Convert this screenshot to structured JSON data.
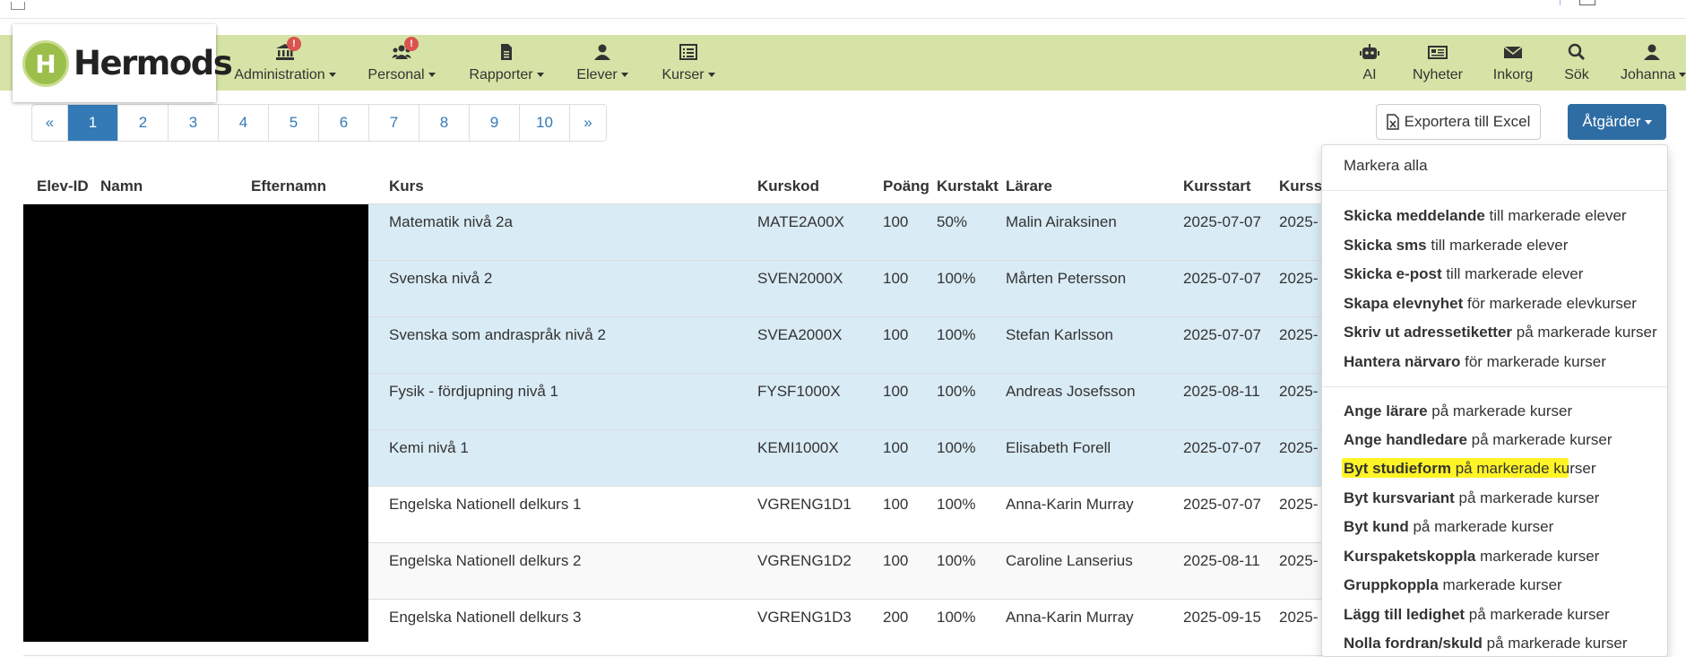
{
  "brand": {
    "logo_letter": "H",
    "logo_text": "Hermods"
  },
  "nav_left": [
    {
      "label": "Administration",
      "icon": "bank-icon",
      "badge": "!"
    },
    {
      "label": "Personal",
      "icon": "users-icon",
      "badge": "!"
    },
    {
      "label": "Rapporter",
      "icon": "file-icon"
    },
    {
      "label": "Elever",
      "icon": "user-icon"
    },
    {
      "label": "Kurser",
      "icon": "list-icon"
    }
  ],
  "nav_right": [
    {
      "label": "AI",
      "icon": "robot-icon"
    },
    {
      "label": "Nyheter",
      "icon": "newspaper-icon"
    },
    {
      "label": "Inkorg",
      "icon": "envelope-icon"
    },
    {
      "label": "Sök",
      "icon": "search-icon"
    },
    {
      "label": "Johanna",
      "icon": "user-icon"
    }
  ],
  "pagination": {
    "prev": "«",
    "pages": [
      "1",
      "2",
      "3",
      "4",
      "5",
      "6",
      "7",
      "8",
      "9",
      "10"
    ],
    "next": "»",
    "active": "1"
  },
  "toolbar": {
    "export_label": "Exportera till Excel",
    "actions_label": "Åtgärder"
  },
  "table": {
    "columns": [
      "Elev-ID",
      "Namn",
      "Efternamn",
      "Kurs",
      "Kurskod",
      "Poäng",
      "Kurstakt",
      "Lärare",
      "Kursstart",
      "Kurssl"
    ],
    "rows": [
      {
        "kurs": "Matematik nivå 2a",
        "kod": "MATE2A00X",
        "poang": "100",
        "takt": "50%",
        "larare": "Malin Airaksinen",
        "start": "2025-07-07",
        "slut": "2025-",
        "style": "hl"
      },
      {
        "kurs": "Svenska nivå 2",
        "kod": "SVEN2000X",
        "poang": "100",
        "takt": "100%",
        "larare": "Mårten Petersson",
        "start": "2025-07-07",
        "slut": "2025-",
        "style": "hl"
      },
      {
        "kurs": "Svenska som andraspråk nivå 2",
        "kod": "SVEA2000X",
        "poang": "100",
        "takt": "100%",
        "larare": "Stefan Karlsson",
        "start": "2025-07-07",
        "slut": "2025-",
        "style": "hl"
      },
      {
        "kurs": "Fysik - fördjupning nivå 1",
        "kod": "FYSF1000X",
        "poang": "100",
        "takt": "100%",
        "larare": "Andreas Josefsson",
        "start": "2025-08-11",
        "slut": "2025-",
        "style": "hl"
      },
      {
        "kurs": "Kemi nivå 1",
        "kod": "KEMI1000X",
        "poang": "100",
        "takt": "100%",
        "larare": "Elisabeth Forell",
        "start": "2025-07-07",
        "slut": "2025-",
        "style": "hl"
      },
      {
        "kurs": "Engelska Nationell delkurs 1",
        "kod": "VGRENG1D1",
        "poang": "100",
        "takt": "100%",
        "larare": "Anna-Karin Murray",
        "start": "2025-07-07",
        "slut": "2025-",
        "style": "plain"
      },
      {
        "kurs": "Engelska Nationell delkurs 2",
        "kod": "VGRENG1D2",
        "poang": "100",
        "takt": "100%",
        "larare": "Caroline Lanserius",
        "start": "2025-08-11",
        "slut": "2025-",
        "style": "alt"
      },
      {
        "kurs": "Engelska Nationell delkurs 3",
        "kod": "VGRENG1D3",
        "poang": "200",
        "takt": "100%",
        "larare": "Anna-Karin Murray",
        "start": "2025-09-15",
        "slut": "2025-",
        "style": "plain"
      }
    ]
  },
  "dropdown": {
    "select_all": "Markera alla",
    "group1": [
      {
        "bold": "Skicka meddelande",
        "rest": " till markerade elever"
      },
      {
        "bold": "Skicka sms",
        "rest": " till markerade elever"
      },
      {
        "bold": "Skicka e-post",
        "rest": " till markerade elever"
      },
      {
        "bold": "Skapa elevnyhet",
        "rest": " för markerade elevkurser"
      },
      {
        "bold": "Skriv ut adressetiketter",
        "rest": " på markerade kurser"
      },
      {
        "bold": "Hantera närvaro",
        "rest": " för markerade kurser"
      }
    ],
    "group2": [
      {
        "bold": "Ange lärare",
        "rest": " på markerade kurser"
      },
      {
        "bold": "Ange handledare",
        "rest": " på markerade kurser"
      },
      {
        "bold": "Byt studieform",
        "rest": " på markerade kurser"
      },
      {
        "bold": "Byt kursvariant",
        "rest": " på markerade kurser"
      },
      {
        "bold": "Byt kund",
        "rest": " på markerade kurser"
      },
      {
        "bold": "Kurspaketskoppla",
        "rest": " markerade kurser"
      },
      {
        "bold": "Gruppkoppla",
        "rest": " markerade kurser"
      },
      {
        "bold": "Lägg till ledighet",
        "rest": " på markerade kurser"
      },
      {
        "bold": "Nolla fordran/skuld",
        "rest": " på markerade kurser"
      }
    ]
  }
}
